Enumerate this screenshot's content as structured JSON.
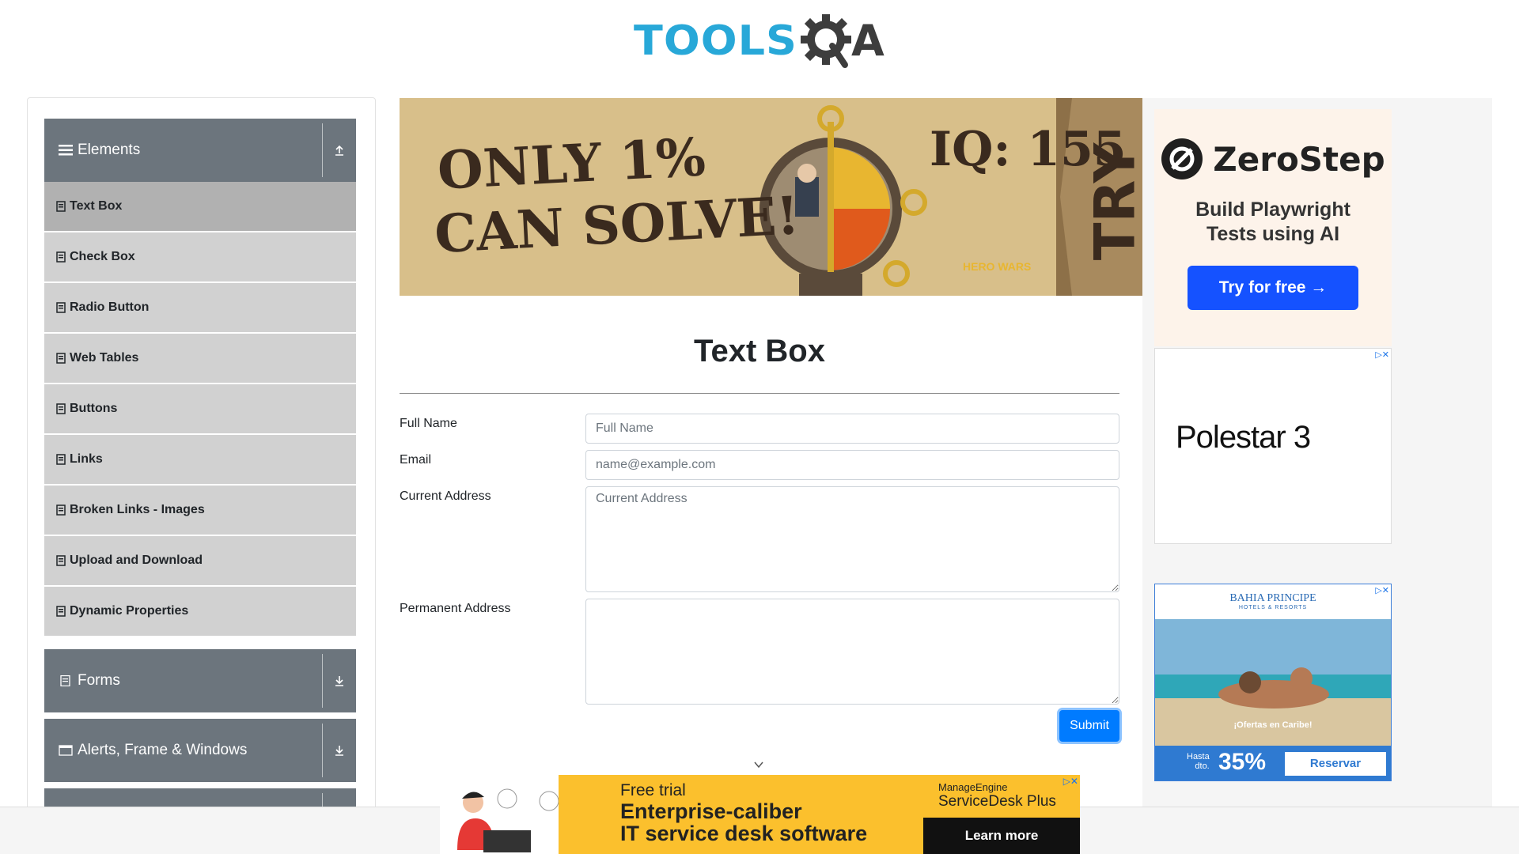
{
  "logo": {
    "tools": "TOOLS",
    "qa_a": "A"
  },
  "sidebar": {
    "groups": [
      {
        "label": "Elements",
        "icon": "hamburger-icon",
        "arrow": "upload-arrow-icon"
      },
      {
        "label": "Forms",
        "icon": "document-icon",
        "arrow": "download-arrow-icon"
      },
      {
        "label": "Alerts, Frame & Windows",
        "icon": "window-icon",
        "arrow": "download-arrow-icon"
      }
    ],
    "items": [
      {
        "label": "Text Box",
        "active": true
      },
      {
        "label": "Check Box"
      },
      {
        "label": "Radio Button"
      },
      {
        "label": "Web Tables"
      },
      {
        "label": "Buttons"
      },
      {
        "label": "Links"
      },
      {
        "label": "Broken Links - Images"
      },
      {
        "label": "Upload and Download"
      },
      {
        "label": "Dynamic Properties"
      }
    ]
  },
  "banner": {
    "line1": "ONLY 1%",
    "line2": "CAN SOLVE!",
    "iq": "IQ: 155",
    "try": "TRY",
    "brand": "HERO WARS"
  },
  "main": {
    "title": "Text Box",
    "fields": {
      "full_name": {
        "label": "Full Name",
        "placeholder": "Full Name"
      },
      "email": {
        "label": "Email",
        "placeholder": "name@example.com"
      },
      "current_address": {
        "label": "Current Address",
        "placeholder": "Current Address"
      },
      "permanent_address": {
        "label": "Permanent Address",
        "placeholder": ""
      }
    },
    "submit": "Submit"
  },
  "ads": {
    "zerostep": {
      "brand": "ZeroStep",
      "headline_1": "Build Playwright",
      "headline_2": "Tests using AI",
      "cta": "Try for free →"
    },
    "polestar": {
      "text": "Polestar 3"
    },
    "bahia": {
      "brand": "BAHIA PRINCIPE",
      "sub": "HOTELS & RESORTS",
      "offer": "¡Ofertas en Caribe!",
      "hasta": "Hasta",
      "dto": "dto.",
      "percent": "35%",
      "cta": "Reservar"
    },
    "bottom": {
      "line1": "Free trial",
      "line2": "Enterprise-caliber",
      "line3": "IT service desk software",
      "brand1": "ManageEngine",
      "brand2": "ServiceDesk Plus",
      "cta": "Learn more"
    }
  },
  "colors": {
    "sidebar_header": "#6c757d",
    "menu_item": "#d1d1d1",
    "menu_active": "#b1b1b1",
    "primary": "#007bff",
    "logo_blue": "#28a8d8"
  }
}
